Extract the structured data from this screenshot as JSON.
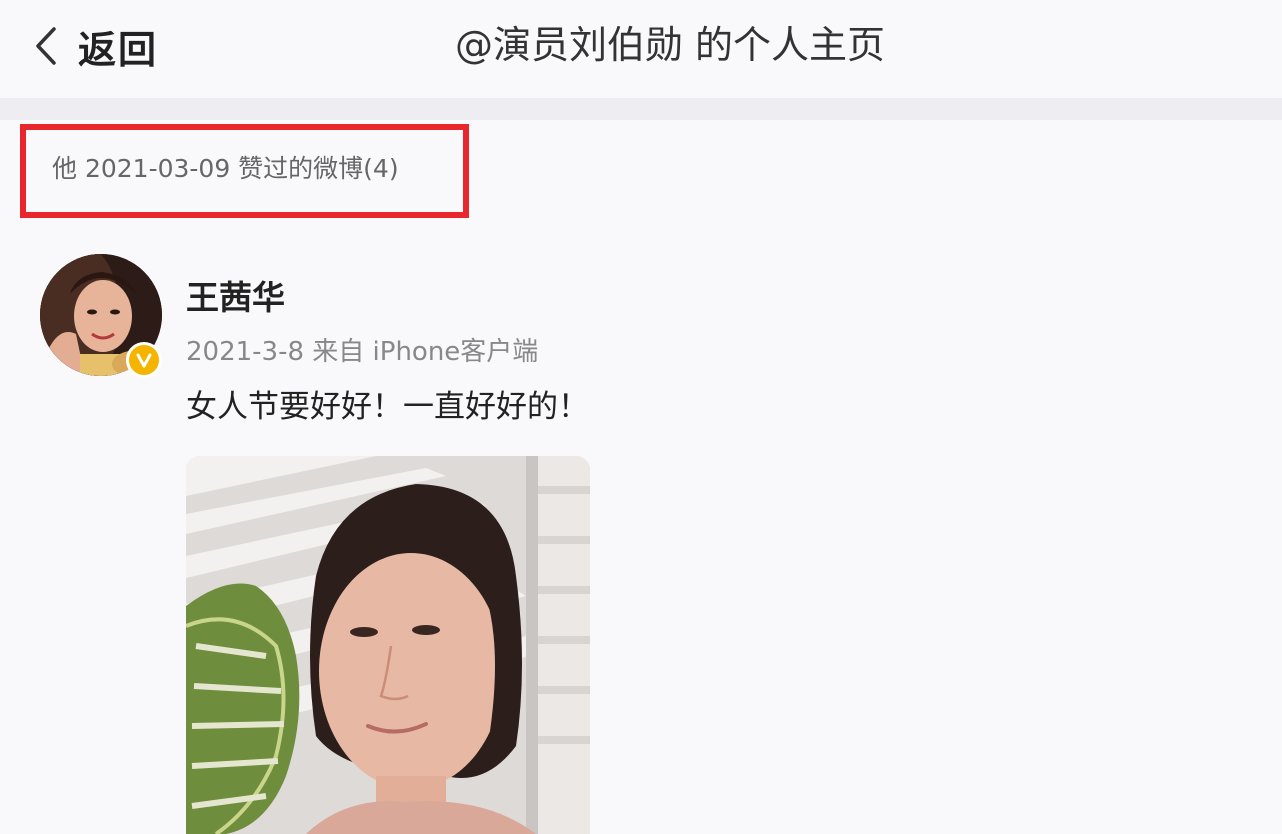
{
  "header": {
    "back_label": "返回",
    "title": "@演员刘伯勋 的个人主页"
  },
  "liked": {
    "summary": "他 2021-03-09 赞过的微博(4)",
    "highlight_color": "#e8262b"
  },
  "post": {
    "author": "王茜华",
    "meta": "2021-3-8 来自 iPhone客户端",
    "text": "女人节要好好！一直好好的！",
    "verified": true,
    "verified_badge_color": "#f5b400"
  },
  "icons": {
    "back": "chevron-left-icon",
    "verified": "verified-v-icon"
  }
}
